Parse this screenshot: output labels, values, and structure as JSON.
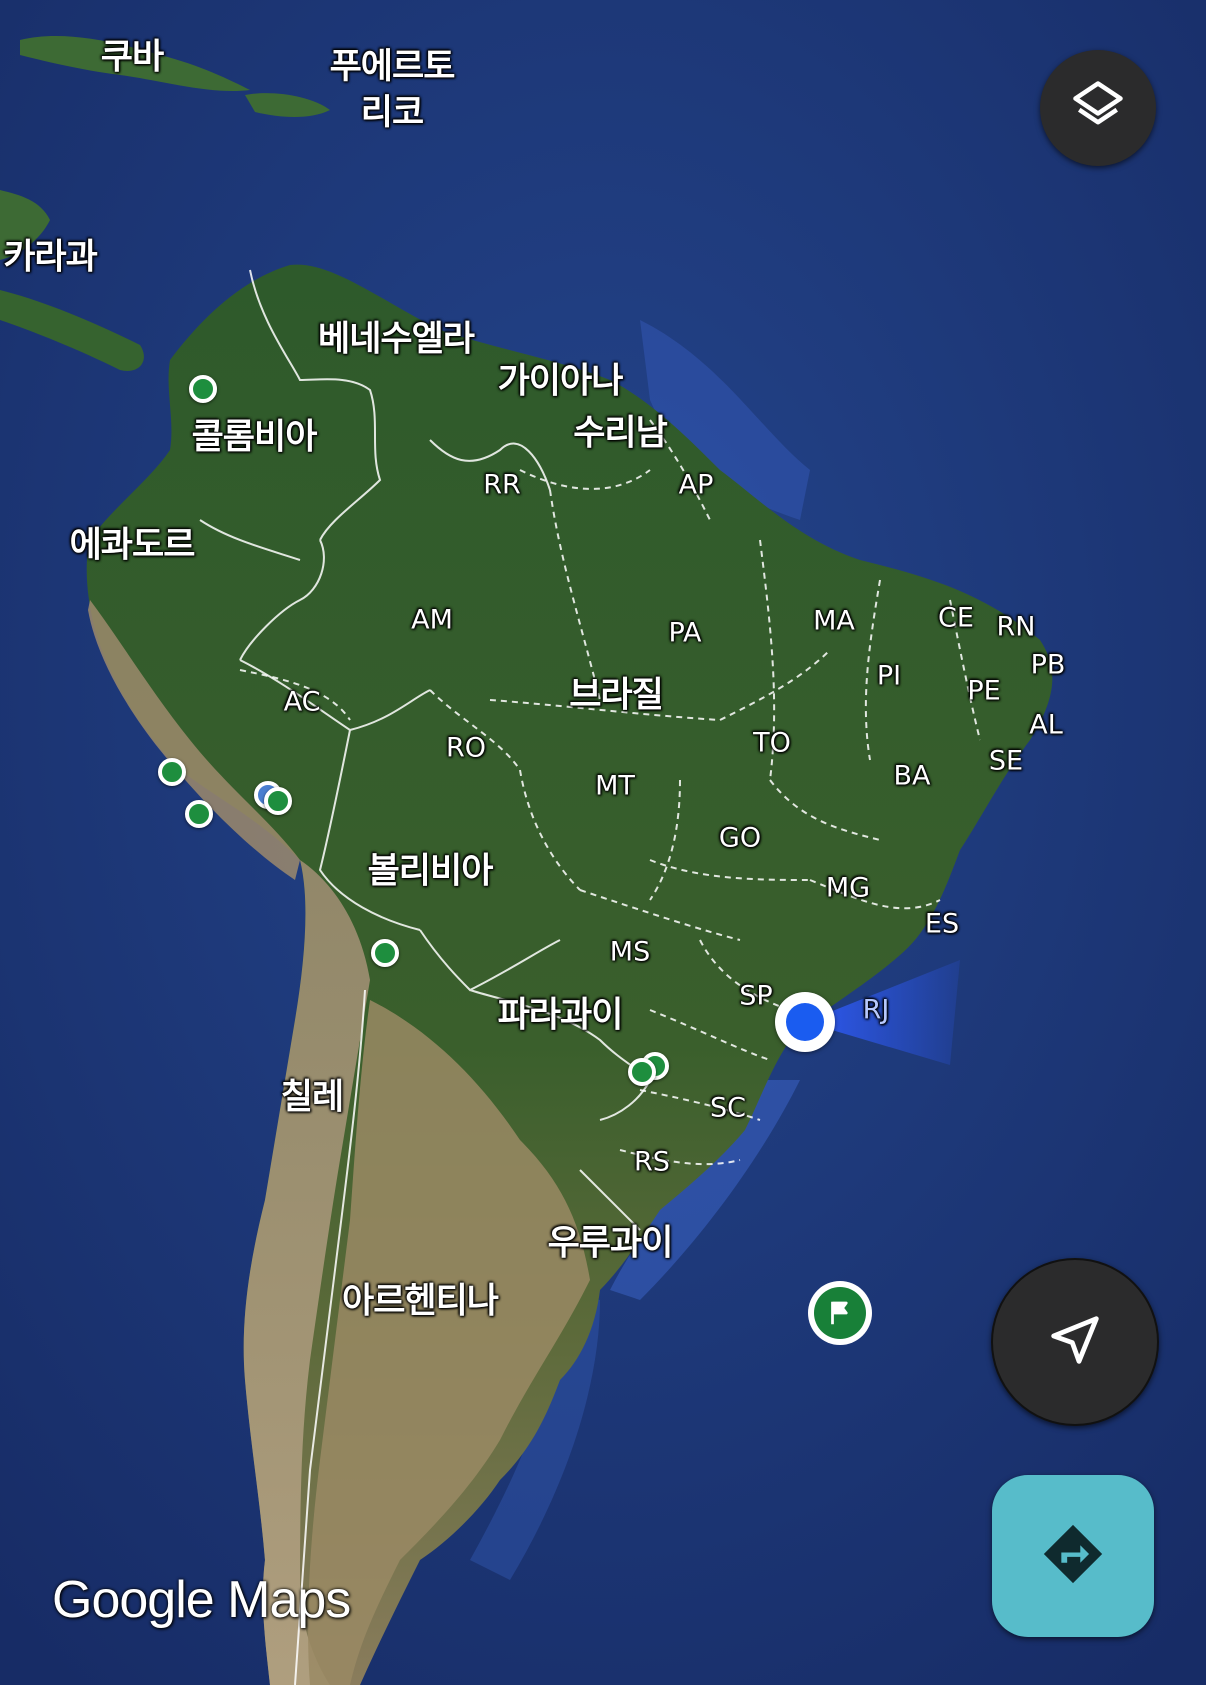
{
  "map": {
    "countries": {
      "cuba": "쿠바",
      "puerto_rico": "푸에르토\n리코",
      "nicaragua": "카라과",
      "venezuela": "베네수엘라",
      "guyana": "가이아나",
      "suriname": "수리남",
      "colombia": "콜롬비아",
      "ecuador": "에콰도르",
      "brazil": "브라질",
      "bolivia": "볼리비아",
      "paraguay": "파라과이",
      "chile": "칠레",
      "uruguay": "우루과이",
      "argentina": "아르헨티나"
    },
    "states": {
      "rr": "RR",
      "ap": "AP",
      "am": "AM",
      "pa": "PA",
      "ma": "MA",
      "ce": "CE",
      "rn": "RN",
      "pb": "PB",
      "pi": "PI",
      "pe": "PE",
      "al": "AL",
      "ac": "AC",
      "ro": "RO",
      "to": "TO",
      "se": "SE",
      "ba": "BA",
      "mt": "MT",
      "go": "GO",
      "mg": "MG",
      "es": "ES",
      "ms": "MS",
      "sp": "SP",
      "rj": "RJ",
      "sc": "SC",
      "rs": "RS"
    },
    "saved_place_count": 8
  },
  "controls": {
    "layers_icon": "layers-icon",
    "locate_icon": "navigation-arrow-icon",
    "directions_icon": "directions-icon"
  },
  "branding": {
    "logo_text": "Google Maps"
  },
  "colors": {
    "ocean": "#1b3577",
    "land_green": "#2d5a2a",
    "land_desert": "#a89675",
    "pin_green": "#1e8e3e",
    "location_blue": "#1a5cf0",
    "directions_button": "#57bcca",
    "control_button": "#2b2b2c"
  }
}
